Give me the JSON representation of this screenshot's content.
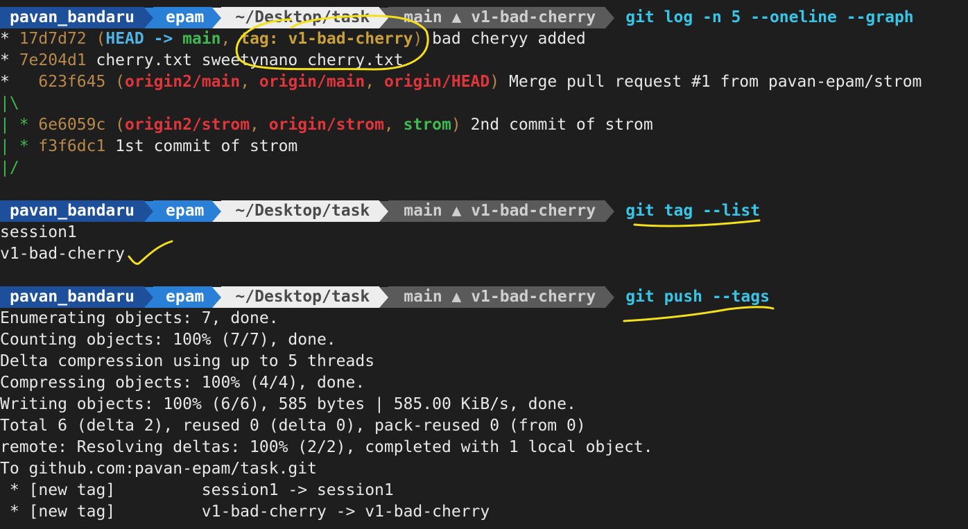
{
  "prompt": {
    "user": "pavan_bandaru",
    "host": "epam",
    "path": "~/Desktop/task",
    "branch": "main ▲ v1-bad-cherry"
  },
  "commands": {
    "log": "git log -n 5 --oneline --graph",
    "tag_list": "git tag --list",
    "push": "git push --tags"
  },
  "log_lines": {
    "c1": {
      "graph": "* ",
      "hash": "17d7d72",
      "open": " (",
      "head": "HEAD -> ",
      "branch": "main",
      "sep": ", ",
      "tag": "tag: v1-bad-cherry",
      "close": ")",
      "msg": " bad cheryy added"
    },
    "c2": {
      "graph": "* ",
      "hash": "7e204d1",
      "msg": " cherry.txt sweetynano cherry.txt"
    },
    "c3": {
      "graph": "*   ",
      "hash": "623f645",
      "open": " (",
      "r1": "origin2/main",
      "sep1": ", ",
      "r2": "origin/main",
      "sep2": ", ",
      "r3": "origin/HEAD",
      "close": ")",
      "msg": " Merge pull request #1 from pavan-epam/strom"
    },
    "g1": "|\\",
    "c4": {
      "graph": "| * ",
      "hash": "6e6059c",
      "open": " (",
      "r1": "origin2/strom",
      "sep1": ", ",
      "r2": "origin/strom",
      "sep2": ", ",
      "local": "strom",
      "close": ")",
      "msg": " 2nd commit of strom"
    },
    "c5": {
      "graph": "| * ",
      "hash": "f3f6dc1",
      "msg": " 1st commit of strom"
    },
    "g2": "|/"
  },
  "tags": [
    "session1",
    "v1-bad-cherry"
  ],
  "push_output": [
    "Enumerating objects: 7, done.",
    "Counting objects: 100% (7/7), done.",
    "Delta compression using up to 5 threads",
    "Compressing objects: 100% (4/4), done.",
    "Writing objects: 100% (6/6), 585 bytes | 585.00 KiB/s, done.",
    "Total 6 (delta 2), reused 0 (delta 0), pack-reused 0 (from 0)",
    "remote: Resolving deltas: 100% (2/2), completed with 1 local object.",
    "To github.com:pavan-epam/task.git",
    " * [new tag]         session1 -> session1",
    " * [new tag]         v1-bad-cherry -> v1-bad-cherry"
  ],
  "colors": {
    "background": "#1e1e1e",
    "command": "#38c6e8",
    "highlight_annotation": "#f5e11b"
  }
}
